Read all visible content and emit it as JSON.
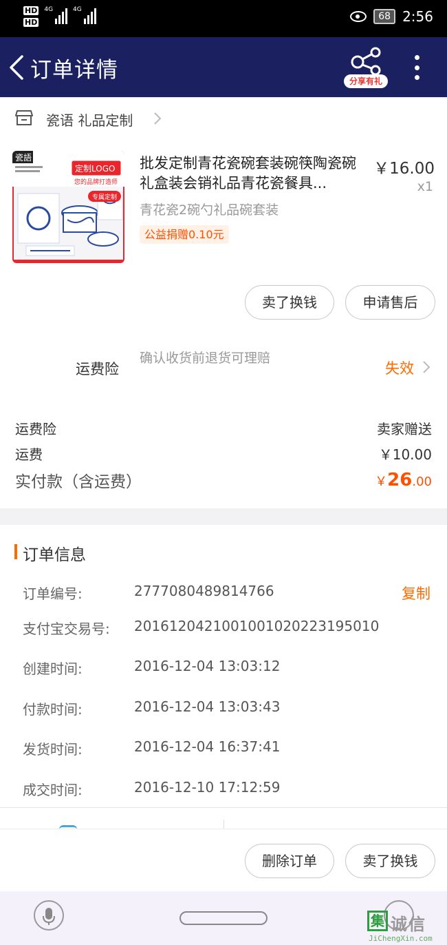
{
  "status_bar": {
    "hd_badges": [
      "HD",
      "HD"
    ],
    "network_labels": [
      "4G",
      "4G"
    ],
    "battery": "68",
    "time": "2:56"
  },
  "header": {
    "title": "订单详情",
    "share_badge": "分享有礼",
    "background_color": "#1b2060"
  },
  "shop": {
    "name": "瓷语 礼品定制"
  },
  "product": {
    "title": "批发定制青花瓷碗套装碗筷陶瓷碗礼盒装会销礼品青花瓷餐具...",
    "price": "￥16.00",
    "quantity": "x1",
    "spec": "青花瓷2碗勺礼品碗套装",
    "charity_tag": "公益捐赠0.10元",
    "image_texts": {
      "brand": "瓷語",
      "logo_banner": "定制LOGO",
      "slogan": "您的品牌打造师",
      "tag": "专属定制"
    }
  },
  "product_actions": {
    "resell": "卖了换钱",
    "after_sale": "申请售后"
  },
  "insurance": {
    "label": "运费险",
    "desc": "确认收货前退货可理赔",
    "status": "失效",
    "status_color": "#ff6a00"
  },
  "fees": {
    "insurance_label": "运费险",
    "insurance_value": "卖家赠送",
    "shipping_label": "运费",
    "shipping_value": "￥10.00",
    "total_label": "实付款（含运费）",
    "total_currency": "￥",
    "total_integer": "26",
    "total_decimal": ".00",
    "accent_color": "#ff5000"
  },
  "order_info": {
    "title": "订单信息",
    "copy_label": "复制",
    "rows": [
      {
        "label": "订单编号:",
        "value": "2777080489814766"
      },
      {
        "label": "支付宝交易号:",
        "value": "2016120421001001020223195010"
      },
      {
        "label": "创建时间:",
        "value": "2016-12-04 13:03:12"
      },
      {
        "label": "付款时间:",
        "value": "2016-12-04 13:03:43"
      },
      {
        "label": "发货时间:",
        "value": "2016-12-04 16:37:41"
      },
      {
        "label": "成交时间:",
        "value": "2016-12-10 17:12:59"
      }
    ]
  },
  "bottom_actions": {
    "delete": "删除订单",
    "resell": "卖了换钱"
  },
  "watermark": {
    "box_char": "集",
    "chars": "诚信",
    "url": "JiChengXin.com"
  }
}
